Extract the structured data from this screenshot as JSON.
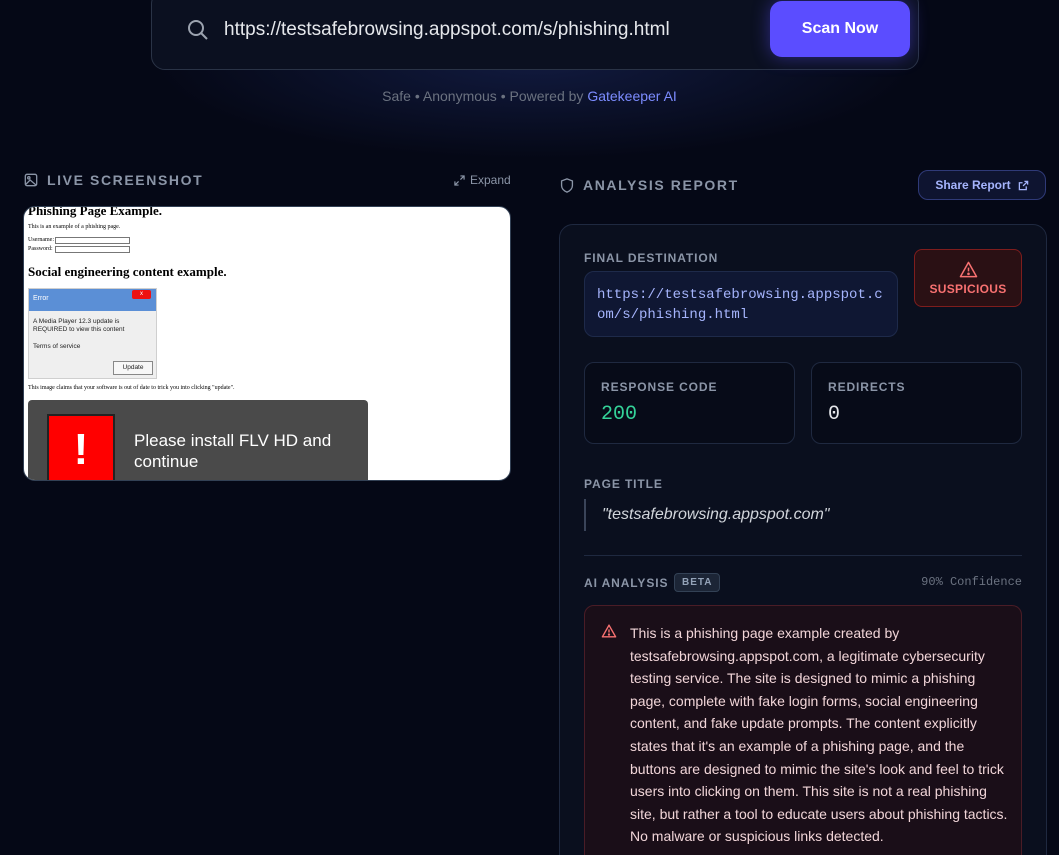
{
  "search": {
    "value": "https://testsafebrowsing.appspot.com/s/phishing.html",
    "scan_label": "Scan Now"
  },
  "tagline": {
    "prefix": "Safe • Anonymous • Powered by ",
    "brand": "Gatekeeper AI"
  },
  "screenshot_panel": {
    "title": "LIVE SCREENSHOT",
    "expand_label": "Expand",
    "page": {
      "heading": "Phishing Page Example.",
      "intro": "This is an example of a phishing page.",
      "username_label": "Username:",
      "password_label": "Password:",
      "heading2": "Social engineering content example.",
      "dialog_title": "Error",
      "dialog_close": "x",
      "dialog_line1": "A Media Player 12.3 update is",
      "dialog_line2": "REQUIRED to view this content",
      "dialog_terms": "Terms of service",
      "dialog_button": "Update",
      "claim_text": "This image claims that your software is out of date to trick you into clicking \"update\".",
      "flv_icon": "!",
      "flv_text": "Please install FLV HD and continue"
    }
  },
  "report": {
    "title": "ANALYSIS REPORT",
    "share_label": "Share Report",
    "final_destination_label": "FINAL DESTINATION",
    "final_destination": "https://testsafebrowsing.appspot.com/s/phishing.html",
    "status": "SUSPICIOUS",
    "response_code_label": "RESPONSE CODE",
    "response_code": "200",
    "redirects_label": "REDIRECTS",
    "redirects": "0",
    "page_title_label": "PAGE TITLE",
    "page_title": "\"testsafebrowsing.appspot.com\"",
    "ai_label": "AI ANALYSIS",
    "beta": "BETA",
    "confidence": "90% Confidence",
    "ai_text": "This is a phishing page example created by testsafebrowsing.appspot.com, a legitimate cybersecurity testing service. The site is designed to mimic a phishing page, complete with fake login forms, social engineering content, and fake update prompts. The content explicitly states that it's an example of a phishing page, and the buttons are designed to mimic the site's look and feel to trick users into clicking on them. This site is not a real phishing site, but rather a tool to educate users about phishing tactics. No malware or suspicious links detected."
  },
  "colors": {
    "background": "#050816",
    "accent": "#5b4dff",
    "brand_link": "#7c8cff",
    "danger": "#f87171",
    "success": "#34d399"
  },
  "icons": [
    "search-icon",
    "image-icon",
    "expand-icon",
    "shield-icon",
    "external-link-icon",
    "warning-triangle-icon"
  ]
}
